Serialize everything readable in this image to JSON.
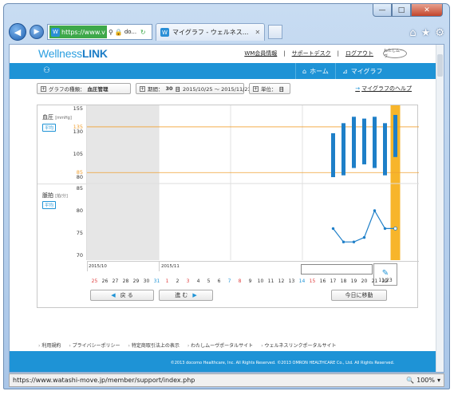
{
  "browser": {
    "ssl_label": "https://www.v",
    "address_extra": "do...",
    "tab_title": "マイグラフ - ウェルネス...",
    "status_url": "https://www.watashi-move.jp/member/support/index.php",
    "zoom": "100%",
    "caption": {
      "min": "—",
      "max": "□",
      "close": "✕"
    }
  },
  "site": {
    "logo_main": "Wellness",
    "logo_strong": "LINK",
    "header_links": [
      "WM会員情報",
      "サポートデスク",
      "ログアウト"
    ],
    "wm_logo": "わたしムーヴ",
    "home_label": "ホーム",
    "mygraph_label": "マイグラフ"
  },
  "filters": {
    "type_label": "グラフの種類：",
    "type_value": "血圧管理",
    "period_label": "期間：",
    "period_days": "30",
    "period_unit": "日",
    "period_range": "2015/10/25 〜 2015/11/23",
    "unit_label": "単位：",
    "unit_value": "日",
    "help_link": "マイグラフのヘルプ"
  },
  "chart_data": {
    "type": "line",
    "sections": [
      {
        "title": "血圧",
        "unit": "[mmHg]",
        "badge": "平均",
        "y_ticks": [
          155,
          135,
          130,
          105,
          85,
          80
        ],
        "reference_lines": [
          135,
          85
        ],
        "ylim": [
          80,
          155
        ],
        "series": [
          {
            "kind": "range-bar",
            "points": [
              {
                "x": "11/17",
                "low": 80,
                "high": 128
              },
              {
                "x": "11/18",
                "low": 82,
                "high": 139
              },
              {
                "x": "11/19",
                "low": 90,
                "high": 146
              },
              {
                "x": "11/20",
                "low": 94,
                "high": 144
              },
              {
                "x": "11/21",
                "low": 90,
                "high": 146
              },
              {
                "x": "11/22",
                "low": 82,
                "high": 139
              },
              {
                "x": "11/23",
                "low": 102,
                "high": 148
              }
            ]
          }
        ]
      },
      {
        "title": "脈拍",
        "unit": "[拍/分]",
        "badge": "平均",
        "y_ticks": [
          85,
          80,
          75,
          70
        ],
        "ylim": [
          70,
          85
        ],
        "series": [
          {
            "kind": "line",
            "points": [
              {
                "x": "11/17",
                "y": 76
              },
              {
                "x": "11/18",
                "y": 73
              },
              {
                "x": "11/19",
                "y": 73
              },
              {
                "x": "11/20",
                "y": 74
              },
              {
                "x": "11/21",
                "y": 80
              },
              {
                "x": "11/22",
                "y": 76
              },
              {
                "x": "11/23",
                "y": 76
              }
            ]
          }
        ]
      }
    ],
    "months": [
      "2015/10",
      "2015/11"
    ],
    "days": [
      {
        "d": "25",
        "t": "sun"
      },
      {
        "d": "26",
        "t": ""
      },
      {
        "d": "27",
        "t": ""
      },
      {
        "d": "28",
        "t": ""
      },
      {
        "d": "29",
        "t": ""
      },
      {
        "d": "30",
        "t": ""
      },
      {
        "d": "31",
        "t": "sat"
      },
      {
        "d": "1",
        "t": "sun"
      },
      {
        "d": "2",
        "t": ""
      },
      {
        "d": "3",
        "t": "sun"
      },
      {
        "d": "4",
        "t": ""
      },
      {
        "d": "5",
        "t": ""
      },
      {
        "d": "6",
        "t": ""
      },
      {
        "d": "7",
        "t": "sat"
      },
      {
        "d": "8",
        "t": "sun"
      },
      {
        "d": "9",
        "t": ""
      },
      {
        "d": "10",
        "t": ""
      },
      {
        "d": "11",
        "t": ""
      },
      {
        "d": "12",
        "t": ""
      },
      {
        "d": "13",
        "t": ""
      },
      {
        "d": "14",
        "t": "sat"
      },
      {
        "d": "15",
        "t": "sun"
      },
      {
        "d": "16",
        "t": ""
      },
      {
        "d": "17",
        "t": ""
      },
      {
        "d": "18",
        "t": ""
      },
      {
        "d": "19",
        "t": ""
      },
      {
        "d": "20",
        "t": ""
      },
      {
        "d": "21",
        "t": ""
      },
      {
        "d": "22",
        "t": ""
      }
    ],
    "selected_day": "11/23",
    "colors": {
      "bar": "#1e7fc8",
      "line": "#1e7fc8",
      "highlight": "#f7b52b",
      "reference": "#f0a030",
      "shade": "#e6e6e6"
    }
  },
  "nav": {
    "prev": "戻 る",
    "next": "進 む",
    "today": "今日に移動"
  },
  "footer": {
    "links": [
      "利用規約",
      "プライバシーポリシー",
      "特定商取引法上の表示",
      "わたしムーヴポータルサイト",
      "ウェルネスリンクポータルサイト"
    ],
    "copyright": "©2013 docomo Healthcare, Inc. All Rights Reserved. ©2013 OMRON HEALTHCARE Co., Ltd. All Rights Reserved."
  }
}
